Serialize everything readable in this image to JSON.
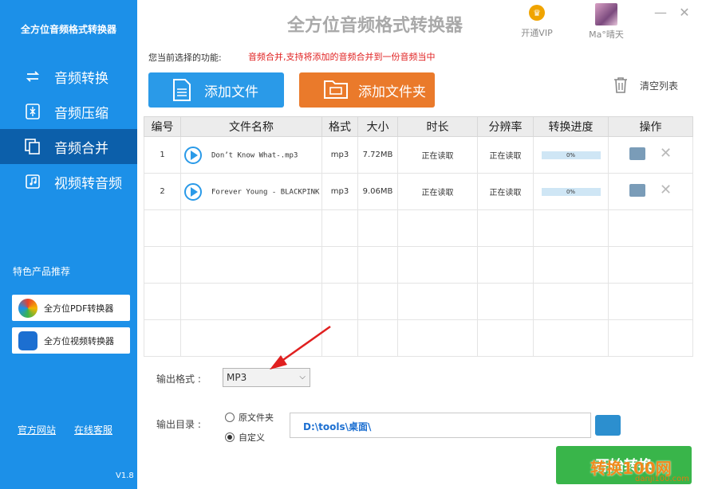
{
  "app": {
    "sidebar_title": "全方位音频格式转换器",
    "header_title": "全方位音频格式转换器",
    "version": "V1.8"
  },
  "nav": [
    {
      "label": "音频转换"
    },
    {
      "label": "音频压缩"
    },
    {
      "label": "音频合并"
    },
    {
      "label": "视频转音频"
    }
  ],
  "recommend": {
    "title": "特色产品推荐",
    "items": [
      {
        "label": "全方位PDF转换器"
      },
      {
        "label": "全方位视频转换器"
      }
    ]
  },
  "footer": {
    "website": "官方网站",
    "support": "在线客服"
  },
  "header": {
    "vip": "开通VIP",
    "user": "Ma°晴天"
  },
  "feature": {
    "label": "您当前选择的功能:",
    "desc": "音频合并,支持将添加的音频合并到一份音频当中"
  },
  "toolbar": {
    "add_file": "添加文件",
    "add_folder": "添加文件夹",
    "clear": "清空列表"
  },
  "table": {
    "headers": [
      "编号",
      "文件名称",
      "格式",
      "大小",
      "时长",
      "分辨率",
      "转换进度",
      "操作"
    ],
    "rows": [
      {
        "no": "1",
        "name": "Don’t  Know  What-.mp3",
        "format": "mp3",
        "size": "7.72MB",
        "duration": "正在读取",
        "resolution": "正在读取",
        "progress": "0%"
      },
      {
        "no": "2",
        "name": "Forever  Young - BLACKPINK",
        "format": "mp3",
        "size": "9.06MB",
        "duration": "正在读取",
        "resolution": "正在读取",
        "progress": "0%"
      }
    ]
  },
  "output": {
    "format_label": "输出格式 :",
    "format_value": "MP3",
    "dir_label": "输出目录 :",
    "radio_original": "原文件夹",
    "radio_custom": "自定义",
    "path": "D:\\tools\\桌面\\"
  },
  "start_button": "开始转换",
  "watermark": {
    "text": "转换100网",
    "url": "danji100.com"
  },
  "colors": {
    "sidebar": "#1c90e8",
    "active": "#0c5faa",
    "add_file": "#2a9ae8",
    "add_folder": "#ea7a2b",
    "start": "#39b54a",
    "desc": "#e02020"
  }
}
